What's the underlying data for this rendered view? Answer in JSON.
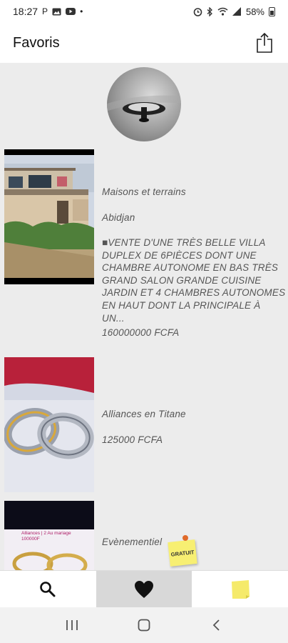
{
  "status_bar": {
    "time": "18:27",
    "icons_left": [
      "p-icon",
      "image-icon",
      "youtube-icon",
      "dot-icon"
    ],
    "icons_right": [
      "alarm-icon",
      "bluetooth-icon",
      "wifi-icon",
      "signal-icon"
    ],
    "battery": "58%"
  },
  "header": {
    "title": "Favoris",
    "share_icon": "share-icon"
  },
  "listings": [
    {
      "category": "Maisons et terrains",
      "location": "Abidjan",
      "description": "■VENTE D'UNE TRÈS BELLE VILLA DUPLEX DE 6PIÈCES DONT UNE CHAMBRE AUTONOME EN BAS TRÈS GRAND SALON GRANDE CUISINE JARDIN ET 4 CHAMBRES AUTONOMES EN HAUT DONT LA PRINCIPALE À UN...",
      "price": "160000000 FCFA"
    },
    {
      "category": "Alliances en Titane",
      "price": "125000 FCFA"
    },
    {
      "category": "Evènementiel",
      "badge": "GRATUIT",
      "image_text": "Alliances | 2 Au mariage 100000F"
    }
  ],
  "bottom_nav": {
    "items": [
      {
        "icon": "search-icon",
        "active": false
      },
      {
        "icon": "heart-icon",
        "active": true
      },
      {
        "icon": "sticky-note-icon",
        "active": false
      }
    ]
  },
  "system_nav": {
    "items": [
      "recent-apps-icon",
      "home-icon",
      "back-icon"
    ]
  },
  "colors": {
    "background": "#ececec",
    "sticky": "#f7ef72",
    "active_tab": "#d8d8d8"
  }
}
